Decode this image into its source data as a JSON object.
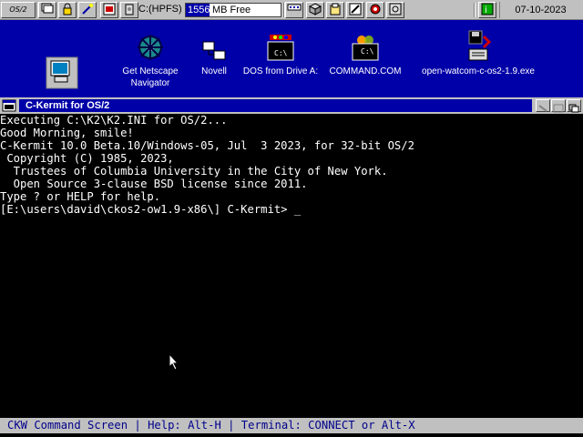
{
  "launchbar": {
    "logo_text": "OS/2",
    "drive_label": "C:(HPFS)",
    "drive_free_value": "1556",
    "drive_free_unit": "MB Free",
    "date": "07-10-2023"
  },
  "desktop": {
    "icons": [
      {
        "label": "Get Netscape\nNavigator"
      },
      {
        "label": "Novell"
      },
      {
        "label": "DOS from Drive A:"
      },
      {
        "label": "COMMAND.COM"
      },
      {
        "label": "open-watcom-c-os2-1.9.exe"
      }
    ],
    "dos_badge": "C:\\"
  },
  "window": {
    "title": "C-Kermit for OS/2",
    "lines": [
      "Executing C:\\K2\\K2.INI for OS/2...",
      "Good Morning, smile!",
      "C-Kermit 10.0 Beta.10/Windows-05, Jul  3 2023, for 32-bit OS/2",
      " Copyright (C) 1985, 2023,",
      "  Trustees of Columbia University in the City of New York.",
      "  Open Source 3-clause BSD license since 2011.",
      "Type ? or HELP for help.",
      "[E:\\users\\david\\ckos2-ow1.9-x86\\] C-Kermit> _"
    ],
    "status": "CKW Command Screen | Help: Alt-H | Terminal: CONNECT or Alt-X"
  },
  "colors": {
    "desktop": "#0000a8",
    "titlebar_active": "#0000a8",
    "status_text": "#00008b"
  }
}
